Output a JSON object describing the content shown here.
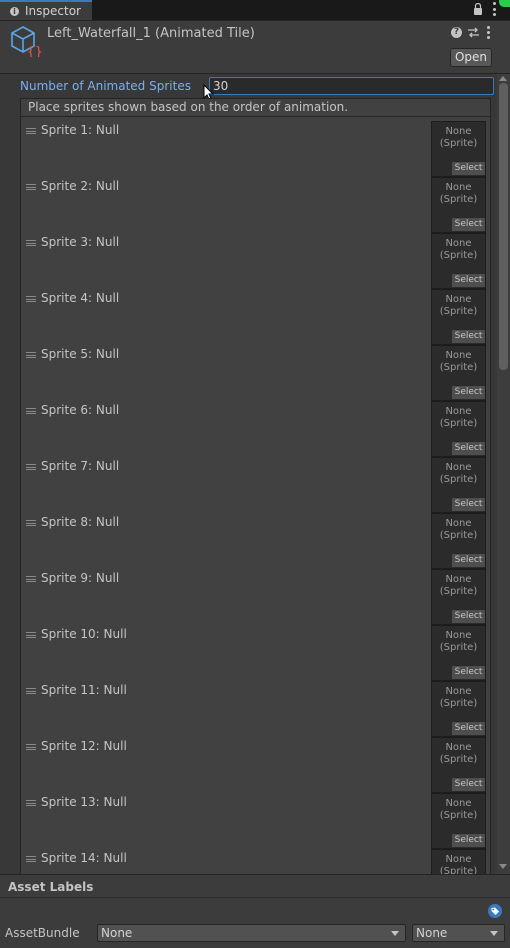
{
  "tab": {
    "title": "Inspector"
  },
  "header": {
    "asset_title": "Left_Waterfall_1 (Animated Tile)",
    "open_label": "Open"
  },
  "main": {
    "count_label": "Number of Animated Sprites",
    "count_value": "30",
    "list_header": "Place sprites shown based on the order of animation.",
    "object_field_none": "None",
    "object_field_type": "(Sprite)",
    "select_label": "Select",
    "sprites": [
      "Sprite 1: Null",
      "Sprite 2: Null",
      "Sprite 3: Null",
      "Sprite 4: Null",
      "Sprite 5: Null",
      "Sprite 6: Null",
      "Sprite 7: Null",
      "Sprite 8: Null",
      "Sprite 9: Null",
      "Sprite 10: Null",
      "Sprite 11: Null",
      "Sprite 12: Null",
      "Sprite 13: Null",
      "Sprite 14: Null"
    ]
  },
  "footer": {
    "title": "Asset Labels",
    "bundle_label": "AssetBundle",
    "bundle_value": "None",
    "variant_value": "None"
  }
}
